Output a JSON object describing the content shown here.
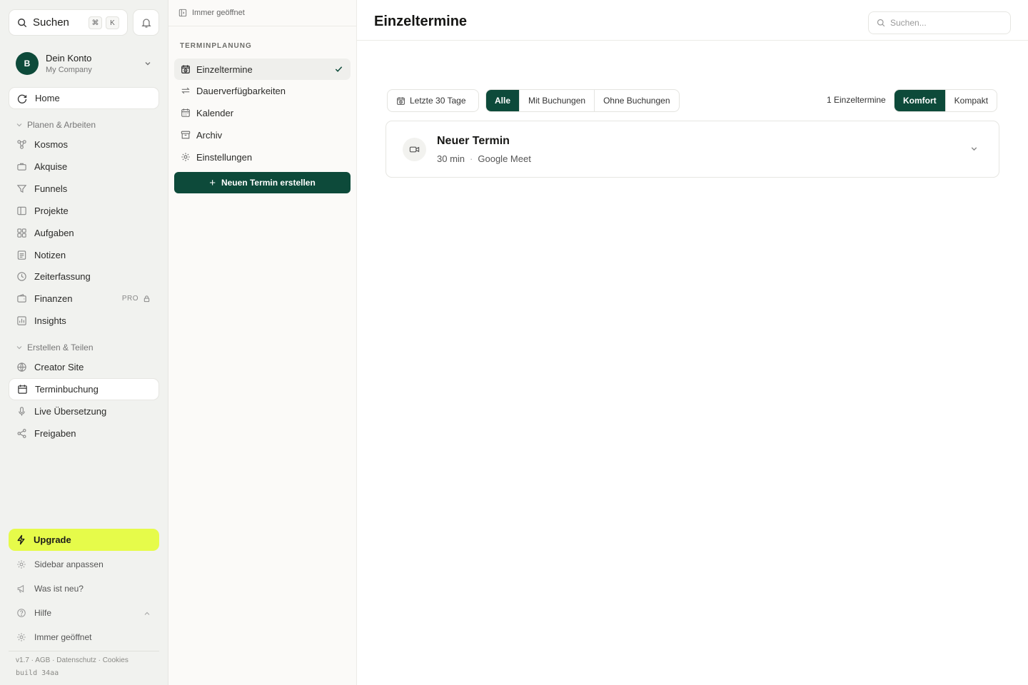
{
  "sidebar": {
    "search_label": "Suchen",
    "shortcut_keys": [
      "⌘",
      "K"
    ],
    "account": {
      "initial": "B",
      "name": "Dein Konto",
      "company": "My Company"
    },
    "home_label": "Home",
    "section_plan": "Planen & Arbeiten",
    "plan_items": [
      {
        "label": "Kosmos",
        "icon": "network-icon"
      },
      {
        "label": "Akquise",
        "icon": "briefcase-icon"
      },
      {
        "label": "Funnels",
        "icon": "filter-icon"
      },
      {
        "label": "Projekte",
        "icon": "columns-icon"
      },
      {
        "label": "Aufgaben",
        "icon": "grid-icon"
      },
      {
        "label": "Notizen",
        "icon": "notes-icon"
      },
      {
        "label": "Zeiterfassung",
        "icon": "clock-icon"
      },
      {
        "label": "Finanzen",
        "icon": "wallet-icon",
        "badge": "PRO"
      },
      {
        "label": "Insights",
        "icon": "chart-icon"
      }
    ],
    "section_create": "Erstellen & Teilen",
    "create_items": [
      {
        "label": "Creator Site",
        "icon": "globe-icon"
      },
      {
        "label": "Terminbuchung",
        "icon": "calendar-icon",
        "active": true
      },
      {
        "label": "Live Übersetzung",
        "icon": "microphone-icon"
      },
      {
        "label": "Freigaben",
        "icon": "share-icon"
      }
    ],
    "upgrade_label": "Upgrade",
    "footer_items": {
      "customize": "Sidebar anpassen",
      "whats_new": "Was ist neu?",
      "help": "Hilfe",
      "always_open": "Immer geöffnet"
    },
    "legal": "v1.7 · AGB · Datenschutz · Cookies",
    "build": "build 34aa"
  },
  "panel": {
    "top_label": "Immer geöffnet",
    "heading": "TERMINPLANUNG",
    "items": [
      {
        "label": "Einzeltermine",
        "icon": "calendar-clock-icon",
        "active": true
      },
      {
        "label": "Dauerverfügbarkeiten",
        "icon": "repeat-icon"
      },
      {
        "label": "Kalender",
        "icon": "calendar-icon"
      },
      {
        "label": "Archiv",
        "icon": "archive-icon"
      },
      {
        "label": "Einstellungen",
        "icon": "gear-icon"
      }
    ],
    "create_button": "Neuen Termin erstellen"
  },
  "main": {
    "title": "Einzeltermine",
    "search_placeholder": "Suchen...",
    "date_filter": "Letzte 30 Tage",
    "booking_filter": {
      "options": [
        "Alle",
        "Mit Buchungen",
        "Ohne Buchungen"
      ],
      "selected": "Alle"
    },
    "count_text": "1 Einzeltermine",
    "view_toggle": {
      "options": [
        "Komfort",
        "Kompakt"
      ],
      "selected": "Komfort"
    },
    "appointments": [
      {
        "title": "Neuer Termin",
        "duration": "30 min",
        "location": "Google Meet",
        "icon": "video-icon"
      }
    ]
  },
  "colors": {
    "brand_green": "#0d4a3a",
    "upgrade_yellow": "#e6fb4a",
    "sidebar_bg": "#f1f2ef"
  }
}
